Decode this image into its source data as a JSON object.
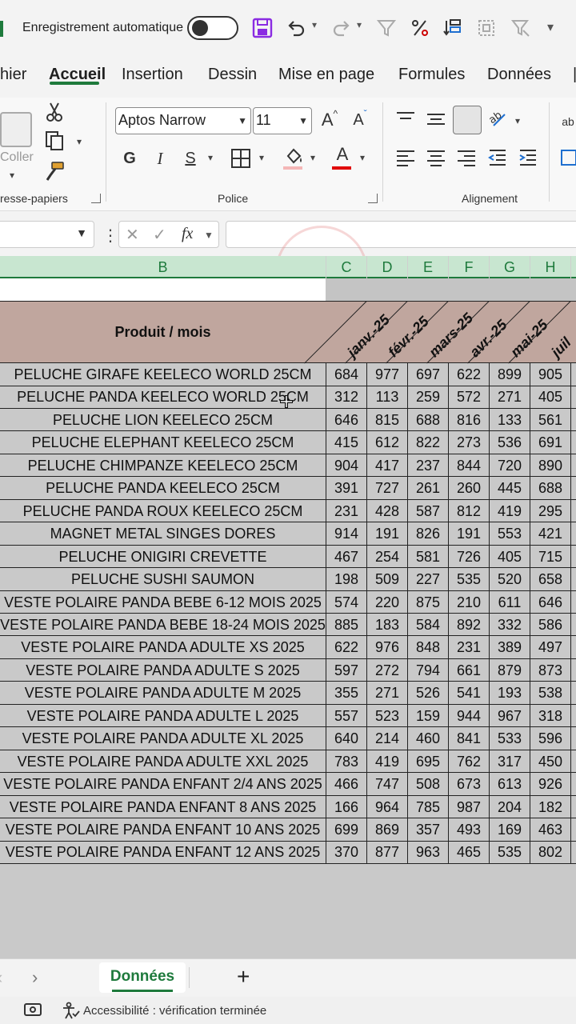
{
  "titlebar": {
    "autosave_label": "Enregistrement automatique",
    "icons": [
      "save-icon",
      "undo-icon",
      "redo-icon",
      "filter-icon",
      "percent-icon",
      "sort-icon",
      "select-icon",
      "filter-clear-icon",
      "more-icon"
    ]
  },
  "tabs": [
    {
      "label": "hier",
      "active": false
    },
    {
      "label": "Accueil",
      "active": true
    },
    {
      "label": "Insertion",
      "active": false
    },
    {
      "label": "Dessin",
      "active": false
    },
    {
      "label": "Mise en page",
      "active": false
    },
    {
      "label": "Formules",
      "active": false
    },
    {
      "label": "Données",
      "active": false
    }
  ],
  "ribbon": {
    "clipboard_label": "resse-papiers",
    "paste_label": "Coller",
    "font_group_label": "Police",
    "font_name": "Aptos Narrow",
    "font_size": "11",
    "bold": "G",
    "italic": "I",
    "underline": "S",
    "increase_font": "A",
    "decrease_font": "A",
    "font_color_letter": "A",
    "alignment_label": "Alignement",
    "colors": {
      "accent": "#1e7a3c",
      "font_color": "#e00000",
      "fill_color": "#f4b6b6"
    }
  },
  "formula_bar": {
    "fx": "fx",
    "value": ""
  },
  "columns": [
    {
      "letter": "B",
      "selected": true
    },
    {
      "letter": "C",
      "selected": true
    },
    {
      "letter": "D",
      "selected": true
    },
    {
      "letter": "E",
      "selected": true
    },
    {
      "letter": "F",
      "selected": true
    },
    {
      "letter": "G",
      "selected": true
    },
    {
      "letter": "H",
      "selected": true
    }
  ],
  "table": {
    "product_header": "Produit / mois",
    "months": [
      "janv.-25",
      "févr.-25",
      "mars-25",
      "avr.-25",
      "mai-25",
      "juil"
    ],
    "header_color": "#c0a69e",
    "rows": [
      {
        "name": "PELUCHE GIRAFE KEELECO WORLD 25CM",
        "values": [
          "684",
          "977",
          "697",
          "622",
          "899",
          "905"
        ]
      },
      {
        "name": "PELUCHE PANDA KEELECO WORLD 25CM",
        "values": [
          "312",
          "113",
          "259",
          "572",
          "271",
          "405"
        ]
      },
      {
        "name": "PELUCHE LION KEELECO 25CM",
        "values": [
          "646",
          "815",
          "688",
          "816",
          "133",
          "561"
        ]
      },
      {
        "name": "PELUCHE ELEPHANT KEELECO 25CM",
        "values": [
          "415",
          "612",
          "822",
          "273",
          "536",
          "691"
        ]
      },
      {
        "name": "PELUCHE CHIMPANZE KEELECO 25CM",
        "values": [
          "904",
          "417",
          "237",
          "844",
          "720",
          "890"
        ]
      },
      {
        "name": "PELUCHE PANDA KEELECO 25CM",
        "values": [
          "391",
          "727",
          "261",
          "260",
          "445",
          "688"
        ]
      },
      {
        "name": "PELUCHE PANDA ROUX KEELECO 25CM",
        "values": [
          "231",
          "428",
          "587",
          "812",
          "419",
          "295"
        ]
      },
      {
        "name": "MAGNET METAL SINGES DORES",
        "values": [
          "914",
          "191",
          "826",
          "191",
          "553",
          "421"
        ]
      },
      {
        "name": "PELUCHE ONIGIRI CREVETTE",
        "values": [
          "467",
          "254",
          "581",
          "726",
          "405",
          "715"
        ]
      },
      {
        "name": "PELUCHE SUSHI SAUMON",
        "values": [
          "198",
          "509",
          "227",
          "535",
          "520",
          "658"
        ]
      },
      {
        "name": "VESTE POLAIRE PANDA BEBE 6-12 MOIS 2025",
        "values": [
          "574",
          "220",
          "875",
          "210",
          "611",
          "646"
        ]
      },
      {
        "name": "VESTE POLAIRE PANDA BEBE 18-24 MOIS 2025",
        "values": [
          "885",
          "183",
          "584",
          "892",
          "332",
          "586"
        ]
      },
      {
        "name": "VESTE POLAIRE PANDA ADULTE XS 2025",
        "values": [
          "622",
          "976",
          "848",
          "231",
          "389",
          "497"
        ]
      },
      {
        "name": "VESTE POLAIRE PANDA ADULTE S 2025",
        "values": [
          "597",
          "272",
          "794",
          "661",
          "879",
          "873"
        ]
      },
      {
        "name": "VESTE POLAIRE PANDA ADULTE M 2025",
        "values": [
          "355",
          "271",
          "526",
          "541",
          "193",
          "538"
        ]
      },
      {
        "name": "VESTE POLAIRE PANDA ADULTE L 2025",
        "values": [
          "557",
          "523",
          "159",
          "944",
          "967",
          "318"
        ]
      },
      {
        "name": "VESTE POLAIRE PANDA ADULTE XL 2025",
        "values": [
          "640",
          "214",
          "460",
          "841",
          "533",
          "596"
        ]
      },
      {
        "name": "VESTE POLAIRE PANDA ADULTE XXL 2025",
        "values": [
          "783",
          "419",
          "695",
          "762",
          "317",
          "450"
        ]
      },
      {
        "name": "VESTE POLAIRE PANDA ENFANT 2/4 ANS 2025",
        "values": [
          "466",
          "747",
          "508",
          "673",
          "613",
          "926"
        ]
      },
      {
        "name": "VESTE POLAIRE PANDA ENFANT 8 ANS 2025",
        "values": [
          "166",
          "964",
          "785",
          "987",
          "204",
          "182"
        ]
      },
      {
        "name": "VESTE POLAIRE PANDA ENFANT 10 ANS 2025",
        "values": [
          "699",
          "869",
          "357",
          "493",
          "169",
          "463"
        ]
      },
      {
        "name": "VESTE POLAIRE PANDA ENFANT 12 ANS 2025",
        "values": [
          "370",
          "877",
          "963",
          "465",
          "535",
          "802"
        ]
      }
    ]
  },
  "sheets": {
    "active": "Données",
    "add": "+"
  },
  "status": {
    "accessibility": "Accessibilité : vérification terminée"
  }
}
